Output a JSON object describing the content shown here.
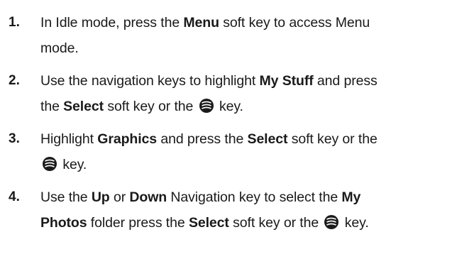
{
  "steps": [
    {
      "number": "1.",
      "text": [
        {
          "t": "In Idle mode, press the "
        },
        {
          "b": "Menu"
        },
        {
          "t": " soft key to access Menu"
        },
        {
          "br": true
        },
        {
          "t": "mode."
        }
      ]
    },
    {
      "number": "2.",
      "text": [
        {
          "t": "Use the navigation keys to highlight "
        },
        {
          "b": "My Stuff"
        },
        {
          "t": " and press"
        },
        {
          "br": true
        },
        {
          "t": "the "
        },
        {
          "b": "Select"
        },
        {
          "t": " soft key or the "
        },
        {
          "icon": "center-select-key-icon"
        },
        {
          "t": " key."
        }
      ]
    },
    {
      "number": "3.",
      "text": [
        {
          "t": "Highlight "
        },
        {
          "b": "Graphics"
        },
        {
          "t": " and press the "
        },
        {
          "b": "Select"
        },
        {
          "t": " soft key or the"
        },
        {
          "br": true
        },
        {
          "icon": "center-select-key-icon"
        },
        {
          "t": " key."
        }
      ]
    },
    {
      "number": "4.",
      "text": [
        {
          "t": "Use the "
        },
        {
          "b": "Up"
        },
        {
          "t": " or "
        },
        {
          "b": "Down"
        },
        {
          "t": " Navigation key to select the "
        },
        {
          "b": "My"
        },
        {
          "br": true
        },
        {
          "b": "Photos"
        },
        {
          "t": " folder press the "
        },
        {
          "b": "Select"
        },
        {
          "t": " soft key or the "
        },
        {
          "icon": "center-select-key-icon"
        },
        {
          "t": " key."
        }
      ]
    }
  ]
}
